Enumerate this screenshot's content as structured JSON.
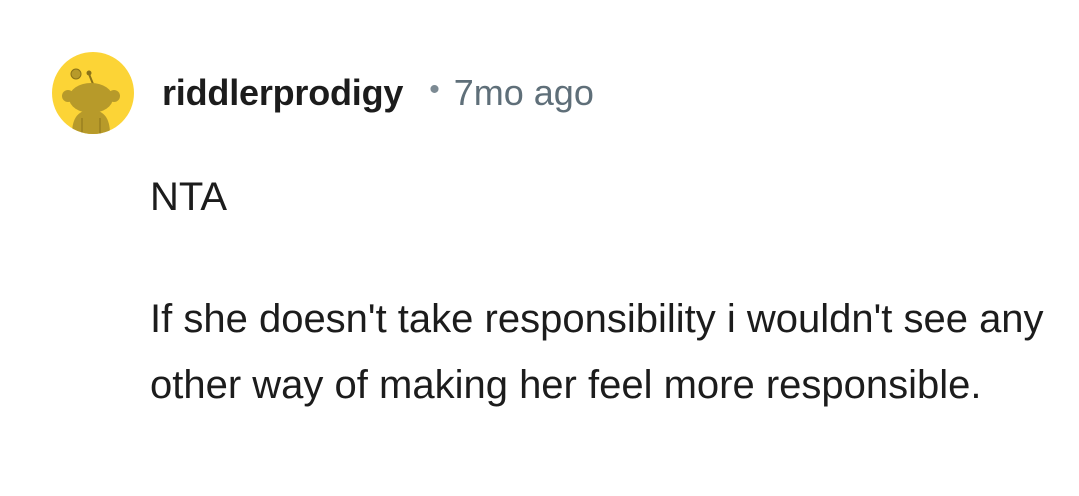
{
  "comment": {
    "author": {
      "username": "riddlerprodigy",
      "avatar_icon": "snoo-avatar-icon",
      "avatar_bg": "#fcd436"
    },
    "separator": "•",
    "timestamp": "7mo ago",
    "body": {
      "verdict": "NTA",
      "text": "If she doesn't take responsibility i wouldn't see any other way of making her feel more responsible."
    }
  }
}
